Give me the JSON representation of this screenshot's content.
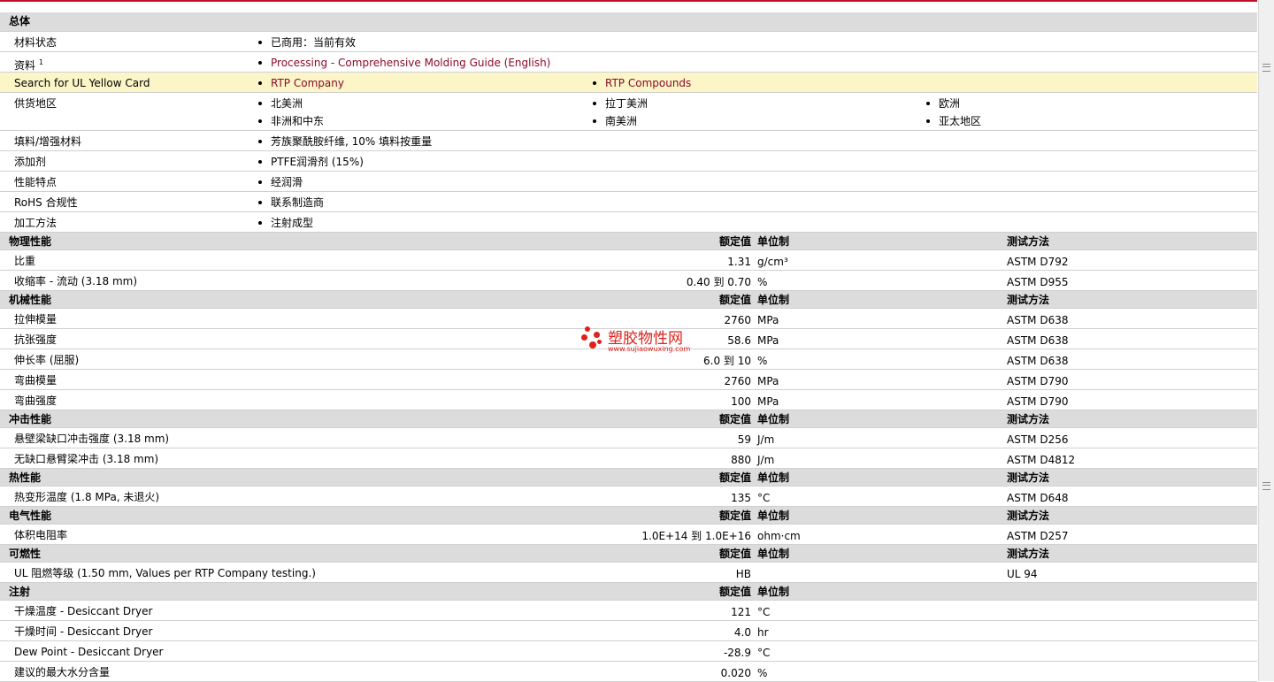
{
  "colors": {
    "accent": "#c0102a",
    "link": "#8b0a2a",
    "section_bg": "#dcdcdc",
    "highlight_bg": "#fbf5c7"
  },
  "headers": {
    "nominal": "额定值",
    "unit": "单位制",
    "test": "测试方法"
  },
  "general": {
    "title": "总体",
    "status_label": "材料状态",
    "status_value": "已商用：当前有效",
    "docs_label": "资料",
    "docs_sup": "1",
    "docs_link": "Processing - Comprehensive Molding Guide (English)",
    "ul_label": "Search for UL Yellow Card",
    "ul_links": [
      "RTP Company",
      "RTP Compounds"
    ],
    "regions_label": "供货地区",
    "regions": [
      "北美洲",
      "拉丁美洲",
      "欧洲",
      "非洲和中东",
      "南美洲",
      "亚太地区"
    ],
    "filler_label": "填料/增强材料",
    "filler_value": "芳族聚酰胺纤维, 10% 填料按重量",
    "additive_label": "添加剂",
    "additive_value": "PTFE润滑剂 (15%)",
    "features_label": "性能特点",
    "features_value": "经润滑",
    "rohs_label": "RoHS 合规性",
    "rohs_value": "联系制造商",
    "process_label": "加工方法",
    "process_value": "注射成型"
  },
  "physical": {
    "title": "物理性能",
    "rows": [
      {
        "name": "比重",
        "value": "1.31",
        "unit": "g/cm³",
        "test": "ASTM D792"
      },
      {
        "name": "收缩率 - 流动 (3.18 mm)",
        "value": "0.40 到 0.70",
        "unit": "%",
        "test": "ASTM D955"
      }
    ]
  },
  "mechanical": {
    "title": "机械性能",
    "rows": [
      {
        "name": "拉伸模量",
        "value": "2760",
        "unit": "MPa",
        "test": "ASTM D638"
      },
      {
        "name": "抗张强度",
        "value": "58.6",
        "unit": "MPa",
        "test": "ASTM D638"
      },
      {
        "name": "伸长率 (屈服)",
        "value": "6.0 到 10",
        "unit": "%",
        "test": "ASTM D638"
      },
      {
        "name": "弯曲模量",
        "value": "2760",
        "unit": "MPa",
        "test": "ASTM D790"
      },
      {
        "name": "弯曲强度",
        "value": "100",
        "unit": "MPa",
        "test": "ASTM D790"
      }
    ]
  },
  "impact": {
    "title": "冲击性能",
    "rows": [
      {
        "name": "悬壁梁缺口冲击强度 (3.18 mm)",
        "value": "59",
        "unit": "J/m",
        "test": "ASTM D256"
      },
      {
        "name": "无缺口悬臂梁冲击 (3.18 mm)",
        "value": "880",
        "unit": "J/m",
        "test": "ASTM D4812"
      }
    ]
  },
  "thermal": {
    "title": "热性能",
    "rows": [
      {
        "name": "热变形温度 (1.8 MPa, 未退火)",
        "value": "135",
        "unit": "°C",
        "test": "ASTM D648"
      }
    ]
  },
  "electrical": {
    "title": "电气性能",
    "rows": [
      {
        "name": "体积电阻率",
        "value": "1.0E+14 到 1.0E+16",
        "unit": "ohm·cm",
        "test": "ASTM D257"
      }
    ]
  },
  "flammability": {
    "title": "可燃性",
    "rows": [
      {
        "name": "UL 阻燃等级 (1.50 mm, Values per RTP Company testing.)",
        "value": "HB",
        "unit": "",
        "test": "UL 94"
      }
    ]
  },
  "injection": {
    "title": "注射",
    "rows": [
      {
        "name": "干燥温度 - Desiccant Dryer",
        "value": "121",
        "unit": "°C",
        "test": ""
      },
      {
        "name": "干燥时间 - Desiccant Dryer",
        "value": "4.0",
        "unit": "hr",
        "test": ""
      },
      {
        "name": "Dew Point - Desiccant Dryer",
        "value": "-28.9",
        "unit": "°C",
        "test": ""
      },
      {
        "name": "建议的最大水分含量",
        "value": "0.020",
        "unit": "%",
        "test": ""
      }
    ]
  },
  "watermark": {
    "name": "塑胶物性网",
    "url": "www.sujiaowuxing.com"
  }
}
